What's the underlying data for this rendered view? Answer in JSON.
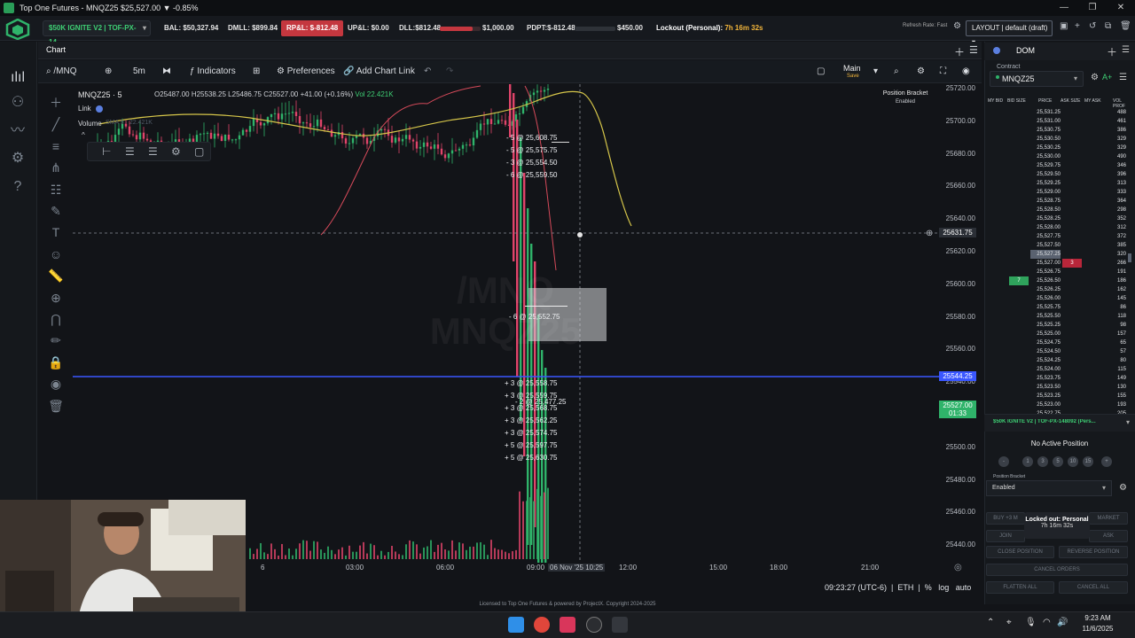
{
  "window": {
    "title": "Top One Futures - MNQZ25 $25,527.00 ▼ -0.85%",
    "controls": [
      "—",
      "❐",
      "✕"
    ]
  },
  "account_bar": {
    "account": "$50K IGNITE V2 | TOF-PX-14...",
    "bal": "BAL: $50,327.94",
    "dmll": "DMLL: $899.84",
    "rpl": "RP&L: $-812.48",
    "upl": "UP&L: $0.00",
    "dll_label": "DLL:$812.48",
    "dll_limit": "$1,000.00",
    "dll_fill": 0.81,
    "pdpt_label": "PDPT:$-812.48",
    "pdpt_limit": "$450.00",
    "lockout_label": "Lockout (Personal):",
    "lockout_time": "7h 16m 32s",
    "refresh_rate": "Refresh Rate: Fast",
    "layout": "LAYOUT | default (draft)"
  },
  "chart": {
    "tab": "Chart",
    "symbol_search": "/MNQ",
    "interval": "5m",
    "indicators_label": "Indicators",
    "preferences_label": "Preferences",
    "add_chart_link_label": "Add Chart Link",
    "layout_name": "Main",
    "layout_sub": "Save",
    "position_bracket_title": "Position Bracket",
    "position_bracket_state": "Enabled",
    "symbol_title": "MNQZ25 · 5",
    "ohlc": "O25487.00 H25538.25 L25486.75 C25527.00 +41.00 (+0.16%)",
    "vol": "Vol 22.421K",
    "link_label": "Link",
    "volume_label": "Volume",
    "sma_label": "SMA 9 · 22.421K",
    "watermark_line1": "/MNQ",
    "watermark_line2": "MNQZ25",
    "y_ticks": [
      "25720.00",
      "25700.00",
      "25680.00",
      "25660.00",
      "25640.00",
      "25620.00",
      "25600.00",
      "25580.00",
      "25560.00",
      "25540.00",
      "25520.00",
      "25500.00",
      "25480.00",
      "25460.00",
      "25440.00"
    ],
    "x_ticks": [
      "6",
      "03:00",
      "06:00",
      "09:00",
      "12:00",
      "15:00",
      "18:00",
      "21:00"
    ],
    "crosshair_date": "06 Nov '25",
    "crosshair_time": "10:25",
    "crosshair_price": "25631.75",
    "blue_line_price": "25544.25",
    "last_price": "25527.00",
    "last_countdown": "01:33",
    "sell_orders": [
      "- 5 @ 25,608.75",
      "- 5 @ 25,575.75",
      "- 3 @ 25,554.50",
      "- 6 @ 25,559.50"
    ],
    "mid_order": "- 6 @ 25,552.75",
    "buy_orders": [
      "+ 3 @ 25,558.75",
      "+ 3 @ 25,559.75",
      "+ 3 @ 25,568.75",
      "+ 3 @ 25,562.25",
      "+ 3 @ 25,574.75",
      "+ 5 @ 25,597.75",
      "+ 5 @ 25,630.75"
    ],
    "extra_order": "- 2 @ 25,477.25",
    "footer_time": "09:23:27 (UTC-6)",
    "footer_session": "ETH",
    "footer_pct": "%",
    "footer_log": "log",
    "footer_auto": "auto"
  },
  "dom": {
    "title": "DOM",
    "contract_label": "Contract",
    "contract": "MNQZ25",
    "headers": [
      "MY BID",
      "BID SIZE",
      "PRICE",
      "ASK SIZE",
      "MY ASK",
      "VOL PROF"
    ],
    "rows": [
      {
        "price": "25,531.25",
        "vol": "488"
      },
      {
        "price": "25,531.00",
        "vol": "461"
      },
      {
        "price": "25,530.75",
        "vol": "386"
      },
      {
        "price": "25,530.50",
        "vol": "329"
      },
      {
        "price": "25,530.25",
        "vol": "329"
      },
      {
        "price": "25,530.00",
        "vol": "490"
      },
      {
        "price": "25,529.75",
        "vol": "346"
      },
      {
        "price": "25,529.50",
        "vol": "396"
      },
      {
        "price": "25,529.25",
        "vol": "313"
      },
      {
        "price": "25,529.00",
        "vol": "333"
      },
      {
        "price": "25,528.75",
        "vol": "364"
      },
      {
        "price": "25,528.50",
        "vol": "298"
      },
      {
        "price": "25,528.25",
        "vol": "352"
      },
      {
        "price": "25,528.00",
        "vol": "312"
      },
      {
        "price": "25,527.75",
        "vol": "372"
      },
      {
        "price": "25,527.50",
        "vol": "385"
      },
      {
        "price": "25,527.25",
        "vol": "320"
      },
      {
        "price": "25,527.00",
        "vol": "266",
        "ask": "3"
      },
      {
        "price": "25,526.75",
        "vol": "191"
      },
      {
        "price": "25,526.50",
        "vol": "186",
        "bid": "7"
      },
      {
        "price": "25,526.25",
        "vol": "162"
      },
      {
        "price": "25,526.00",
        "vol": "145"
      },
      {
        "price": "25,525.75",
        "vol": "86"
      },
      {
        "price": "25,525.50",
        "vol": "118"
      },
      {
        "price": "25,525.25",
        "vol": "98"
      },
      {
        "price": "25,525.00",
        "vol": "157"
      },
      {
        "price": "25,524.75",
        "vol": "65"
      },
      {
        "price": "25,524.50",
        "vol": "57"
      },
      {
        "price": "25,524.25",
        "vol": "80"
      },
      {
        "price": "25,524.00",
        "vol": "115"
      },
      {
        "price": "25,523.75",
        "vol": "149"
      },
      {
        "price": "25,523.50",
        "vol": "130"
      },
      {
        "price": "25,523.25",
        "vol": "155"
      },
      {
        "price": "25,523.00",
        "vol": "193"
      },
      {
        "price": "25,522.75",
        "vol": "205"
      }
    ],
    "account": "$50K IGNITE V2 | TOF-PX-148092 (Pers...",
    "no_position": "No Active Position",
    "qty_buttons": [
      "-",
      "1",
      "3",
      "5",
      "10",
      "15",
      "+"
    ],
    "bracket_label": "Position Bracket",
    "bracket_value": "Enabled",
    "buttons": {
      "buy": "BUY +3 M",
      "market": "MARKET",
      "join": "JOIN",
      "ask": "ASK",
      "close": "CLOSE POSITION",
      "reverse": "REVERSE POSITION",
      "cancel_orders": "CANCEL ORDERS",
      "flatten": "FLATTEN ALL",
      "cancel_all": "CANCEL ALL"
    },
    "lockout_tooltip_title": "Locked out: Personal",
    "lockout_tooltip_time": "7h 16m 32s"
  },
  "license": "Licensed to Top One Futures & powered by ProjectX. Copyright 2024-2025",
  "taskbar": {
    "time": "9:23 AM",
    "date": "11/6/2025"
  },
  "colors": {
    "accent_green": "#3ecf74",
    "loss_red": "#c4373f",
    "candle_red": "#e0446a",
    "candle_green": "#2fb36a",
    "blue_line": "#3a57ff",
    "sma_yellow": "#d6c64a"
  }
}
